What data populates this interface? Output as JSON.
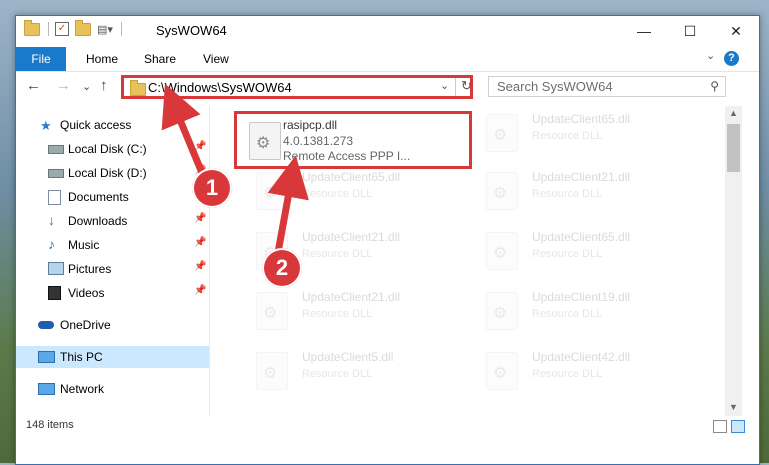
{
  "window": {
    "title": "SysWOW64",
    "minimize": "—",
    "maximize": "☐",
    "close": "✕"
  },
  "ribbon": {
    "tabs": [
      "File",
      "Home",
      "Share",
      "View"
    ],
    "expand": "⌄",
    "help": "?"
  },
  "navigation": {
    "back": "←",
    "forward": "→",
    "recent": "⌄",
    "up": "↑",
    "address": "C:\\Windows\\SysWOW64",
    "search_placeholder": "Search SysWOW64"
  },
  "sidebar": {
    "items": [
      {
        "label": "Quick access",
        "icon": "star-icon",
        "pinned": false
      },
      {
        "label": "Local Disk (C:)",
        "icon": "drive-icon",
        "pinned": true
      },
      {
        "label": "Local Disk (D:)",
        "icon": "drive-icon",
        "pinned": true
      },
      {
        "label": "Documents",
        "icon": "documents-icon",
        "pinned": true
      },
      {
        "label": "Downloads",
        "icon": "downloads-icon",
        "pinned": true
      },
      {
        "label": "Music",
        "icon": "music-icon",
        "pinned": true
      },
      {
        "label": "Pictures",
        "icon": "pictures-icon",
        "pinned": true
      },
      {
        "label": "Videos",
        "icon": "videos-icon",
        "pinned": true
      },
      {
        "label": "OneDrive",
        "icon": "cloud-icon",
        "pinned": false
      },
      {
        "label": "This PC",
        "icon": "computer-icon",
        "pinned": false
      },
      {
        "label": "Network",
        "icon": "network-icon",
        "pinned": false
      }
    ]
  },
  "files": {
    "highlighted": {
      "name": "rasipcp.dll",
      "version": "4.0.1381.273",
      "description": "Remote Access PPP I..."
    },
    "faded": [
      {
        "name": "UpdateClient65.dll",
        "description": "Resource DLL"
      },
      {
        "name": "UpdateClient65.dll",
        "description": "Resource DLL"
      },
      {
        "name": "UpdateClient21.dll",
        "description": "Resource DLL"
      },
      {
        "name": "UpdateClient21.dll",
        "description": "Resource DLL"
      },
      {
        "name": "UpdateClient65.dll",
        "description": "Resource DLL"
      },
      {
        "name": "UpdateClient21.dll",
        "description": "Resource DLL"
      },
      {
        "name": "UpdateClient19.dll",
        "description": "Resource DLL"
      },
      {
        "name": "UpdateClient5.dll",
        "description": "Resource DLL"
      },
      {
        "name": "UpdateClient42.dll",
        "description": "Resource DLL"
      }
    ]
  },
  "status": {
    "item_count": "148 items"
  },
  "callouts": [
    "1",
    "2"
  ],
  "colors": {
    "accent": "#1979ca",
    "highlight_border": "#d9383b",
    "selected_nav": "#cce8ff"
  }
}
